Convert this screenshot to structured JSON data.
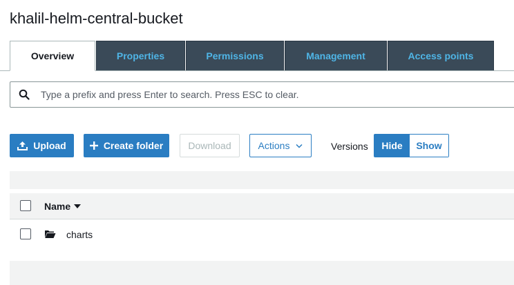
{
  "bucket": {
    "title": "khalil-helm-central-bucket"
  },
  "tabs": [
    {
      "label": "Overview",
      "active": true
    },
    {
      "label": "Properties",
      "active": false
    },
    {
      "label": "Permissions",
      "active": false
    },
    {
      "label": "Management",
      "active": false
    },
    {
      "label": "Access points",
      "active": false
    }
  ],
  "search": {
    "placeholder": "Type a prefix and press Enter to search. Press ESC to clear.",
    "value": "",
    "icon": "search-icon"
  },
  "toolbar": {
    "upload_label": "Upload",
    "upload_icon": "upload-icon",
    "create_folder_label": "Create folder",
    "create_folder_icon": "plus-icon",
    "download_label": "Download",
    "actions_label": "Actions",
    "actions_icon": "chevron-down-icon",
    "versions_label": "Versions",
    "hide_label": "Hide",
    "show_label": "Show",
    "versions_selected": "Hide"
  },
  "table": {
    "columns": [
      {
        "label": "Name",
        "sort": "descending"
      }
    ],
    "rows": [
      {
        "name": "charts",
        "type": "folder",
        "icon": "folder-icon"
      }
    ]
  },
  "colors": {
    "accent": "#2a7dc2",
    "tab_bg": "#3a4a58",
    "tab_text": "#4fb5e6",
    "band_bg": "#f2f3f3"
  }
}
